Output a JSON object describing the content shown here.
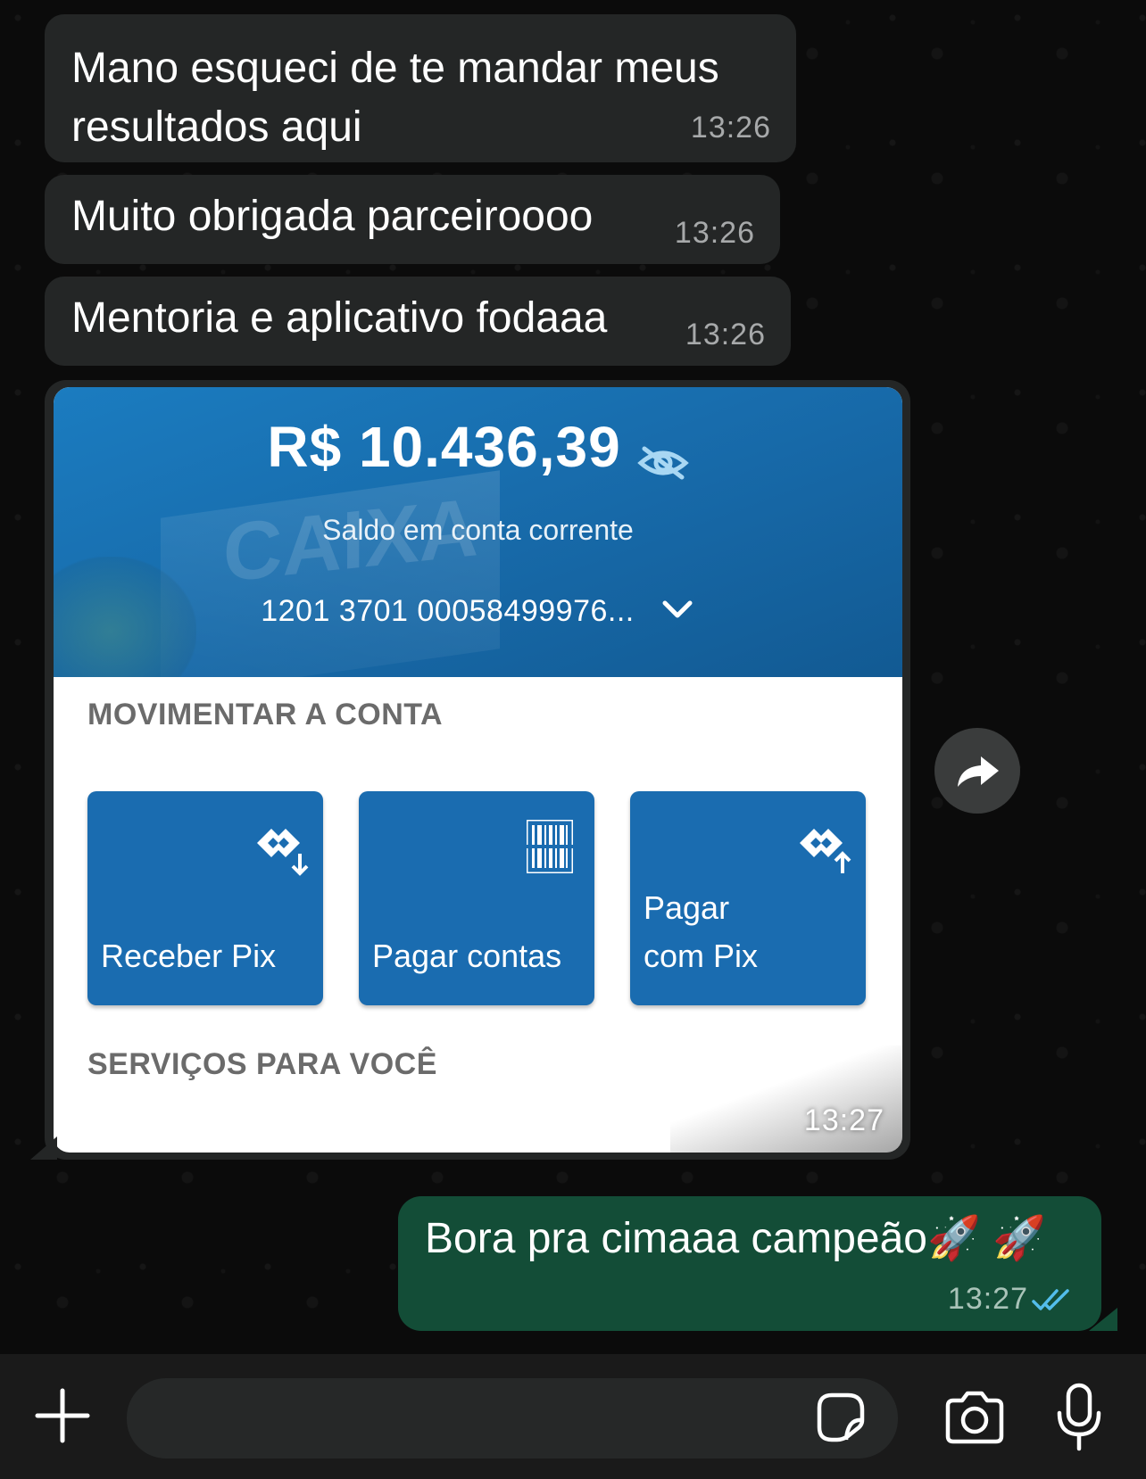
{
  "messages_incoming": [
    {
      "text_line1": "Mano esqueci de te mandar meus",
      "text_line2": "resultados aqui",
      "time": "13:26"
    },
    {
      "text": "Muito obrigada parceiroooo",
      "time": "13:26"
    },
    {
      "text": "Mentoria e aplicativo fodaaa",
      "time": "13:26"
    }
  ],
  "image_message": {
    "time": "13:27",
    "screenshot": {
      "balance": "R$ 10.436,39",
      "balance_label": "Saldo em conta corrente",
      "account_number": "1201 3701 00058499976...",
      "building_text": "CAIXA",
      "section_move": "MOVIMENTAR A CONTA",
      "tiles": [
        {
          "label": "Receber Pix",
          "icon": "pix-receive-icon"
        },
        {
          "label": "Pagar contas",
          "icon": "barcode-icon"
        },
        {
          "label": "Pagar\ncom Pix",
          "icon": "pix-send-icon"
        }
      ],
      "section_services": "SERVIÇOS PARA VOCÊ"
    }
  },
  "message_outgoing": {
    "text": "Bora pra cimaaa campeão🚀 🚀",
    "time": "13:27",
    "status": "read"
  },
  "input_bar": {
    "placeholder": ""
  },
  "colors": {
    "incoming_bubble": "#242626",
    "outgoing_bubble": "#134d37",
    "read_tick": "#53bdeb",
    "bank_blue": "#1a6cb0"
  }
}
